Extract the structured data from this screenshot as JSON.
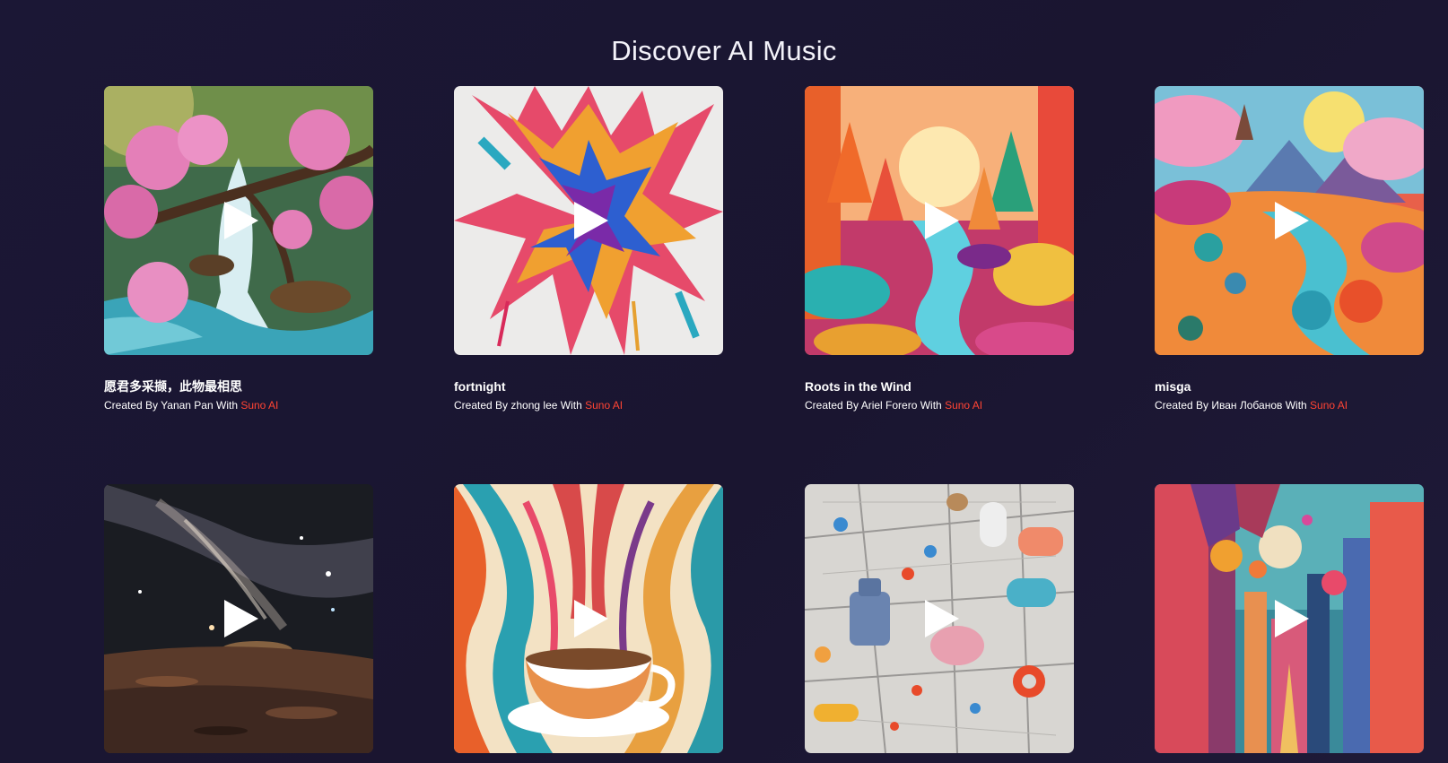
{
  "page": {
    "title": "Discover AI Music"
  },
  "colors": {
    "background": "#1b1735",
    "accent_link": "#ff4433",
    "text": "#ffffff"
  },
  "cards": [
    {
      "title": "愿君多采撷，此物最相思",
      "created_prefix": "Created By ",
      "creator": "Yanan Pan",
      "with_text": " With ",
      "tool": "Suno AI",
      "art_desc": "cherry-blossom-waterfall"
    },
    {
      "title": "fortnight",
      "created_prefix": "Created By ",
      "creator": "zhong lee",
      "with_text": " With ",
      "tool": "Suno AI",
      "art_desc": "paint-splash"
    },
    {
      "title": "Roots in the Wind",
      "created_prefix": "Created By ",
      "creator": "Ariel Forero",
      "with_text": " With ",
      "tool": "Suno AI",
      "art_desc": "colorful-forest-river"
    },
    {
      "title": "misga",
      "created_prefix": "Created By ",
      "creator": "Иван Лобанов",
      "with_text": " With ",
      "tool": "Suno AI",
      "art_desc": "fantasy-landscape"
    },
    {
      "art_desc": "galaxy-desert"
    },
    {
      "art_desc": "coffee-swirls"
    },
    {
      "art_desc": "pills-on-map"
    },
    {
      "art_desc": "geometric-city"
    }
  ]
}
